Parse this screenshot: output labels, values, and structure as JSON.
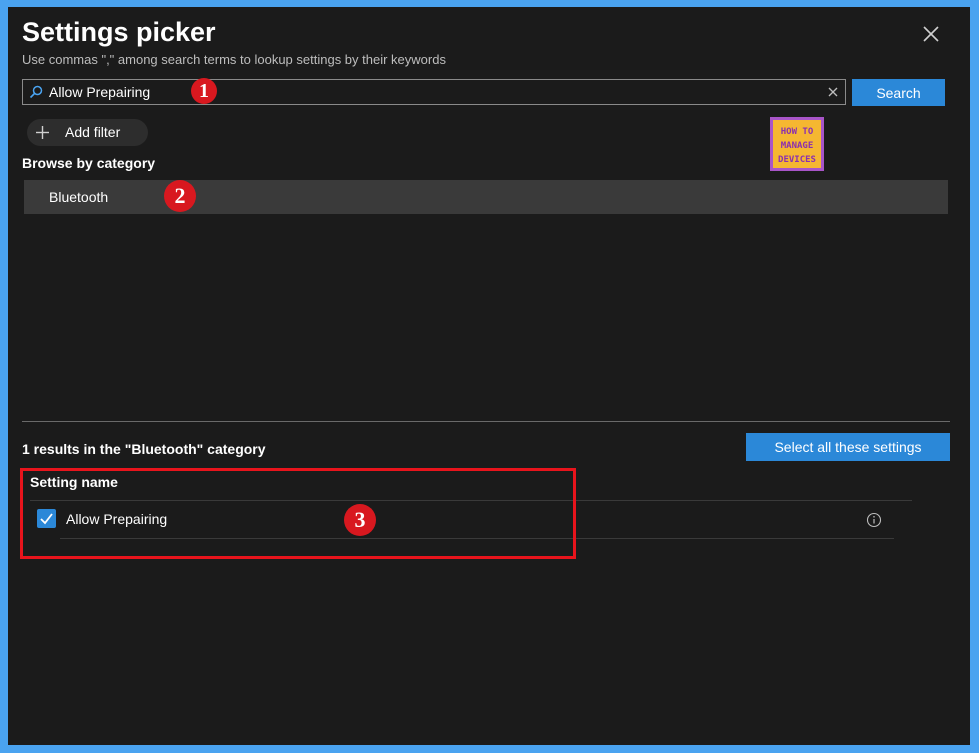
{
  "panel": {
    "title": "Settings picker",
    "subtitle": "Use commas \",\" among search terms to lookup settings by their keywords"
  },
  "search": {
    "value": "Allow Prepairing",
    "button_label": "Search"
  },
  "filter": {
    "add_label": "Add filter"
  },
  "browse": {
    "label": "Browse by category",
    "categories": [
      {
        "label": "Bluetooth"
      }
    ]
  },
  "logo": {
    "line1": "HOW TO",
    "line2": "MANAGE",
    "line3": "DEVICES"
  },
  "results": {
    "summary": "1 results in the \"Bluetooth\" category",
    "select_all_label": "Select all these settings",
    "column_header": "Setting name",
    "items": [
      {
        "label": "Allow Prepairing",
        "checked": true
      }
    ]
  },
  "annotations": {
    "badge1": "1",
    "badge2": "2",
    "badge3": "3"
  },
  "colors": {
    "accent": "#2b88d8",
    "highlight": "#e8141c",
    "frame": "#4aa3f0",
    "background": "#1b1b1b"
  },
  "icons": [
    "search-icon",
    "clear-icon",
    "close-icon",
    "plus-icon",
    "checkmark-icon",
    "info-icon"
  ]
}
